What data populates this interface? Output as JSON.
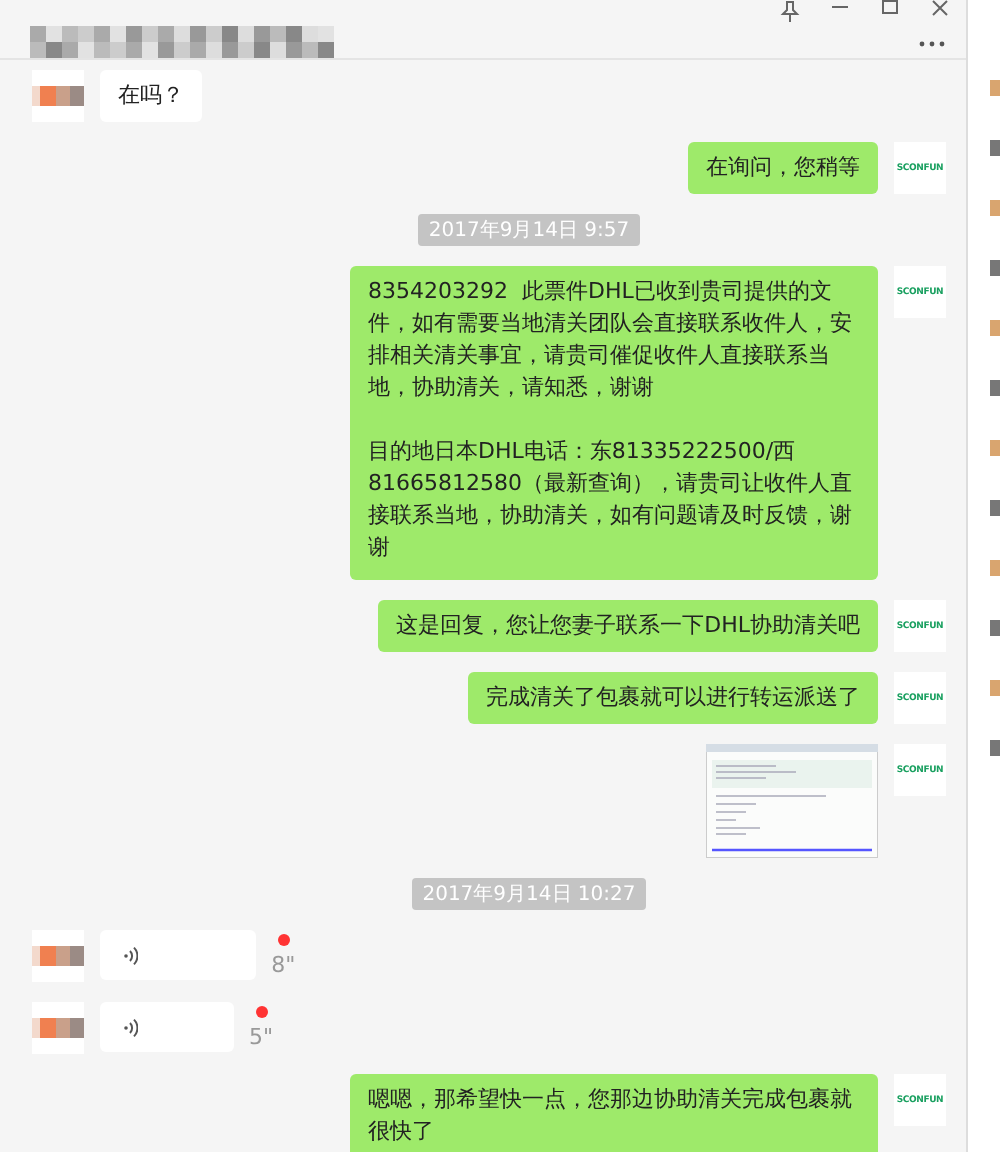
{
  "messages": [
    {
      "kind": "text",
      "outgoing": false,
      "text": "在吗？"
    },
    {
      "kind": "text",
      "outgoing": true,
      "avatar": "SCONFUN",
      "text": "在询问，您稍等"
    },
    {
      "kind": "time",
      "text": "2017年9月14日 9:57"
    },
    {
      "kind": "text",
      "outgoing": true,
      "avatar": "SCONFUN",
      "paragraphs": [
        "8354203292  此票件DHL已收到贵司提供的文件，如有需要当地清关团队会直接联系收件人，安排相关清关事宜，请贵司催促收件人直接联系当地，协助清关，请知悉，谢谢",
        "目的地日本DHL电话：东81335222500/西81665812580（最新查询），请贵司让收件人直接联系当地，协助清关，如有问题请及时反馈，谢谢"
      ]
    },
    {
      "kind": "text",
      "outgoing": true,
      "avatar": "SCONFUN",
      "text": "这是回复，您让您妻子联系一下DHL协助清关吧"
    },
    {
      "kind": "text",
      "outgoing": true,
      "avatar": "SCONFUN",
      "text": "完成清关了包裹就可以进行转运派送了"
    },
    {
      "kind": "image",
      "outgoing": true,
      "avatar": "SCONFUN"
    },
    {
      "kind": "time",
      "text": "2017年9月14日 10:27"
    },
    {
      "kind": "voice",
      "outgoing": false,
      "duration": "8\"",
      "unread": true
    },
    {
      "kind": "voice",
      "outgoing": false,
      "duration": "5\"",
      "unread": true
    },
    {
      "kind": "text",
      "outgoing": true,
      "avatar": "SCONFUN",
      "text": "嗯嗯，那希望快一点，您那边协助清关完成包裹就很快了"
    }
  ]
}
